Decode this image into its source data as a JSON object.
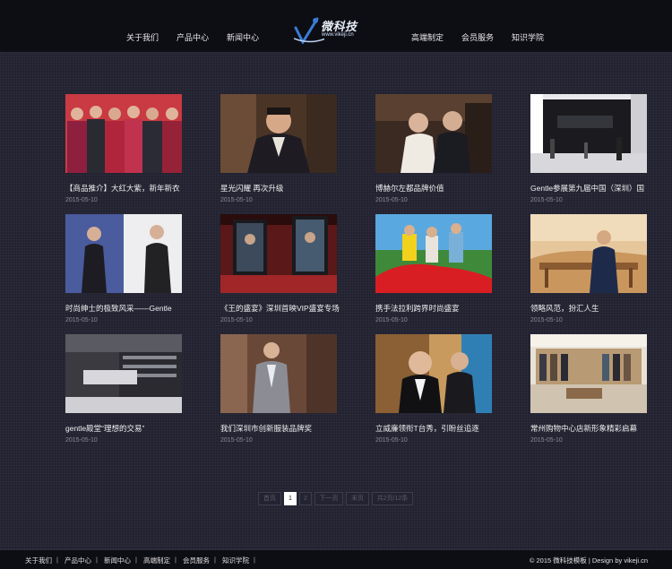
{
  "header": {
    "nav_left": [
      "关于我们",
      "产品中心",
      "新闻中心"
    ],
    "nav_right": [
      "高端制定",
      "会员服务",
      "知识学院"
    ],
    "logo_name": "微科技",
    "logo_url": "www.vikeji.cn",
    "logo_color": "#3a7bd5"
  },
  "news": [
    {
      "title": "【商品推介】大红大紫，新年新衣",
      "date": "2015-05-10",
      "image": "men-in-red-suits"
    },
    {
      "title": "星光闪耀 再次升级",
      "date": "2015-05-10",
      "image": "man-in-dark-suit"
    },
    {
      "title": "博赫尔左都品牌价值",
      "date": "2015-05-10",
      "image": "two-gentlemen-in-shop"
    },
    {
      "title": "Gentle参展第九届中国（深圳）国",
      "date": "2015-05-10",
      "image": "exhibition-booth"
    },
    {
      "title": "时尚绅士的极致风采——Gentle",
      "date": "2015-05-10",
      "image": "two-men-in-coats"
    },
    {
      "title": "《王的盛宴》深圳首映VIP盛宴专场",
      "date": "2015-05-10",
      "image": "premiere-posters"
    },
    {
      "title": "携手法拉利跨界时尚盛宴",
      "date": "2015-05-10",
      "image": "group-with-red-car"
    },
    {
      "title": "领略风范，扮汇人生",
      "date": "2015-05-10",
      "image": "man-in-desert"
    },
    {
      "title": "gentle殿堂“理想的交易”",
      "date": "2015-05-10",
      "image": "store-interior"
    },
    {
      "title": "我们深圳市创新服装品牌奖",
      "date": "2015-05-10",
      "image": "man-in-grey-suit"
    },
    {
      "title": "立威廉领衔T台秀，引盼丝追逐",
      "date": "2015-05-10",
      "image": "two-men-portrait"
    },
    {
      "title": "常州购物中心店新形象精彩启幕",
      "date": "2015-05-10",
      "image": "boutique-interior"
    }
  ],
  "pagination": {
    "labels": [
      "首页",
      "1",
      "2",
      "下一页",
      "末页",
      "共2页/12条"
    ],
    "active": 1
  },
  "footer": {
    "links": [
      "关于我们",
      "产品中心",
      "新闻中心",
      "高端制定",
      "会员服务",
      "知识学院"
    ],
    "copyright": "© 2015 微科技模板 | Design by vikeji.cn"
  }
}
